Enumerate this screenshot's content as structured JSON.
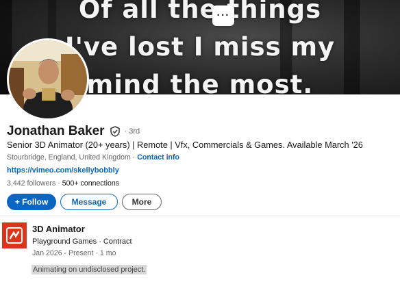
{
  "banner": {
    "quote_lines": [
      "Of all the things",
      "I've lost I miss my",
      "mind the most."
    ]
  },
  "toolbar": {
    "more_glyph": "···"
  },
  "profile": {
    "name": "Jonathan Baker",
    "verified_icon": "shield-check-icon",
    "degree": "· 3rd",
    "headline": "Senior 3D Animator (20+ years) | Remote | Vfx, Commercials & Games. Available March '26",
    "location": "Stourbridge, England, United Kingdom ·",
    "contact_info": "Contact info",
    "website": "https://vimeo.com/skellybobbly",
    "followers": "3,442 followers",
    "separator": "·",
    "connections": "500+ connections"
  },
  "actions": {
    "follow_label": "+ Follow",
    "message_label": "Message",
    "more_label": "More"
  },
  "experience": {
    "title": "3D Animator",
    "company": "Playground Games · Contract",
    "dates": "Jan 2026 - Present · 1 mo",
    "description": "Animating on undisclosed project.",
    "logo_color": "#d9361c"
  },
  "colors": {
    "accent": "#0a66c2",
    "text_secondary": "#666666"
  }
}
